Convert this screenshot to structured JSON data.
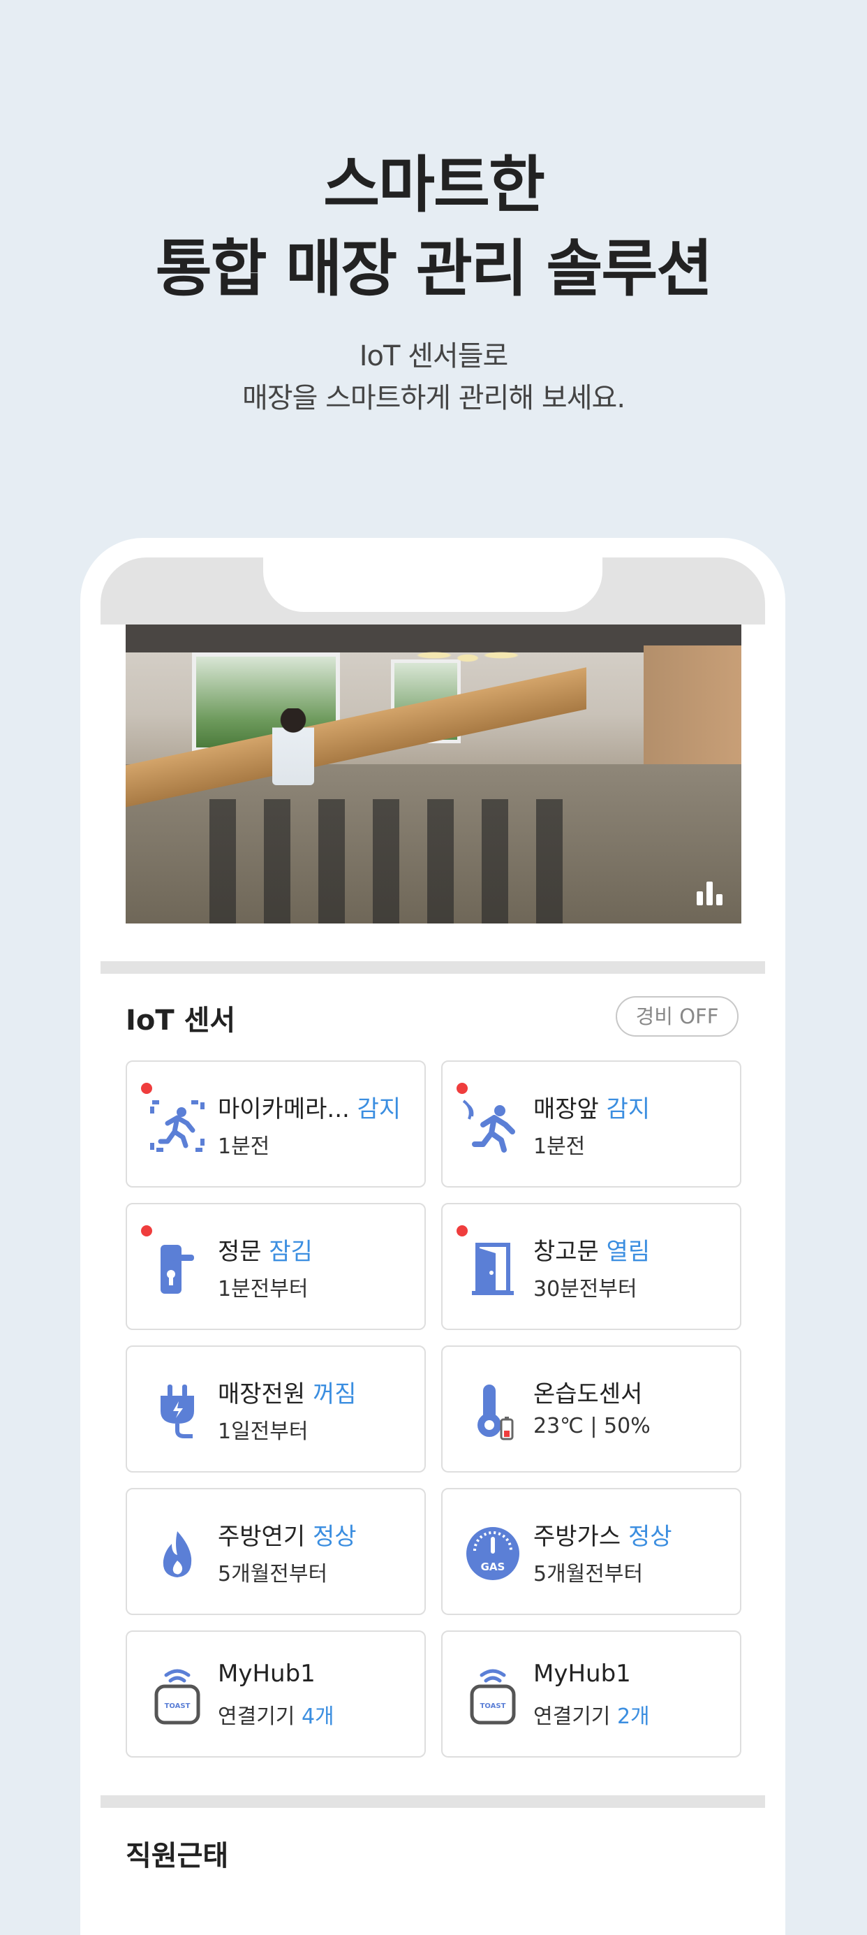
{
  "hero": {
    "title_line1": "스마트한",
    "title_line2": "통합 매장 관리 솔루션",
    "subtitle_line1": "IoT 센서들로",
    "subtitle_line2": "매장을 스마트하게 관리해 보세요."
  },
  "iot": {
    "title": "IoT 센서",
    "guard_button": "경비 OFF",
    "cards": [
      {
        "name": "마이카메라...",
        "status": "감지",
        "time": "1분전",
        "icon": "motion-camera-icon",
        "alert": true
      },
      {
        "name": "매장앞",
        "status": "감지",
        "time": "1분전",
        "icon": "motion-sensor-icon",
        "alert": true
      },
      {
        "name": "정문",
        "status": "잠김",
        "time": "1분전부터",
        "icon": "door-lock-icon",
        "alert": true
      },
      {
        "name": "창고문",
        "status": "열림",
        "time": "30분전부터",
        "icon": "open-door-icon",
        "alert": true
      },
      {
        "name": "매장전원",
        "status": "꺼짐",
        "time": "1일전부터",
        "icon": "power-plug-icon",
        "alert": false
      },
      {
        "name": "온습도센서",
        "status": "",
        "time": "23℃ | 50%",
        "icon": "thermometer-icon",
        "alert": false
      },
      {
        "name": "주방연기",
        "status": "정상",
        "time": "5개월전부터",
        "icon": "smoke-flame-icon",
        "alert": false
      },
      {
        "name": "주방가스",
        "status": "정상",
        "time": "5개월전부터",
        "icon": "gas-gauge-icon",
        "alert": false
      },
      {
        "name": "MyHub1",
        "status": "",
        "time_prefix": "연결기기",
        "time_value": "4개",
        "icon": "hub-icon",
        "alert": false
      },
      {
        "name": "MyHub1",
        "status": "",
        "time_prefix": "연결기기",
        "time_value": "2개",
        "icon": "hub-icon",
        "alert": false
      }
    ]
  },
  "attendance": {
    "title": "직원근태"
  },
  "colors": {
    "background": "#e6edf3",
    "accent_blue": "#3b8ee0",
    "icon_blue": "#5b7fd6",
    "alert_red": "#ef3d3d"
  }
}
